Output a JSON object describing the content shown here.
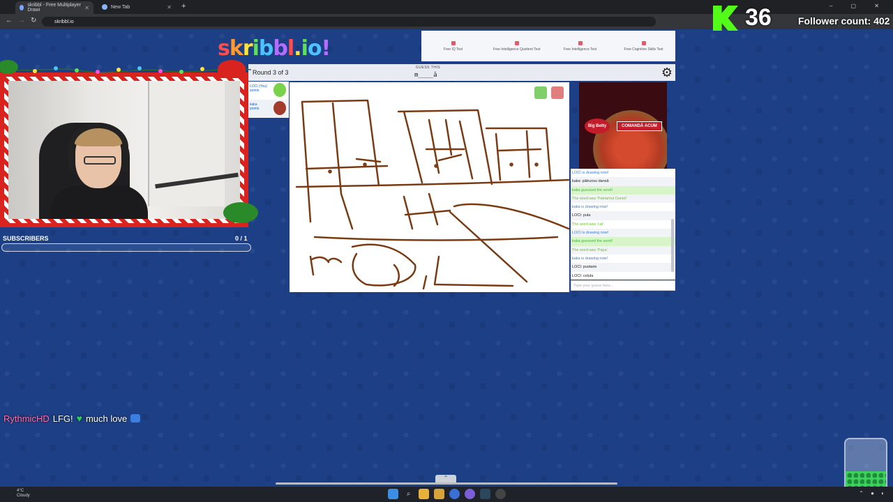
{
  "browser": {
    "tabs": [
      {
        "label": "skribbl - Free Multiplayer Drawi",
        "active": true
      },
      {
        "label": "New Tab",
        "active": false
      }
    ],
    "url": "skribbl.io"
  },
  "stream_overlay": {
    "kick_count": "36",
    "follower_label": "Follower count: 402",
    "subscribers_label": "SUBSCRIBERS",
    "subscribers_count": "0 / 1",
    "subscribers_progress": 0,
    "chat": {
      "user": "RythmicHD",
      "text_a": "LFG!",
      "text_b": "much love"
    }
  },
  "ads": {
    "top_items": [
      "Free IQ Test",
      "Free Intelligence Quotient Test",
      "Free Intelligence Test",
      "Free Cognitive Skills Test"
    ],
    "side_brand": "Big Betty",
    "side_cta": "COMANDĂ ACUM"
  },
  "game": {
    "logo": "skribbl.io",
    "round": "Round 3 of 3",
    "guess_label": "GUESS THIS",
    "word_hint": "m____ă",
    "players": [
      {
        "name": "LOCI (You)",
        "points": "points"
      },
      {
        "name": "kaka",
        "points": "points"
      }
    ],
    "chat_messages": [
      {
        "text": "LOCI is drawing now!",
        "kind": "draw"
      },
      {
        "text": "kaka: pătrunsu dansă",
        "kind": "normal"
      },
      {
        "text": "kaka guessed the word!",
        "kind": "guessed"
      },
      {
        "text": "The word was 'Patriarhul Daniel'",
        "kind": "word"
      },
      {
        "text": "kaka is drawing now!",
        "kind": "draw"
      },
      {
        "text": "LOCI: pula",
        "kind": "normal"
      },
      {
        "text": "The word was 'cat'",
        "kind": "word"
      },
      {
        "text": "LOCI is drawing now!",
        "kind": "draw"
      },
      {
        "text": "kaka guessed the word!",
        "kind": "guessed"
      },
      {
        "text": "The word was 'Papa'",
        "kind": "word"
      },
      {
        "text": "kaka is drawing now!",
        "kind": "draw"
      },
      {
        "text": "LOCI: pustarie",
        "kind": "normal"
      },
      {
        "text": "LOCI: celula",
        "kind": "normal"
      }
    ],
    "chat_placeholder": "Type your guess here..."
  },
  "taskbar": {
    "weather_temp": "4°C",
    "weather_desc": "Cloudy"
  },
  "colors": {
    "background": "#1c3f86",
    "drawing": "#7a3b12",
    "kick_green": "#53fc18"
  }
}
